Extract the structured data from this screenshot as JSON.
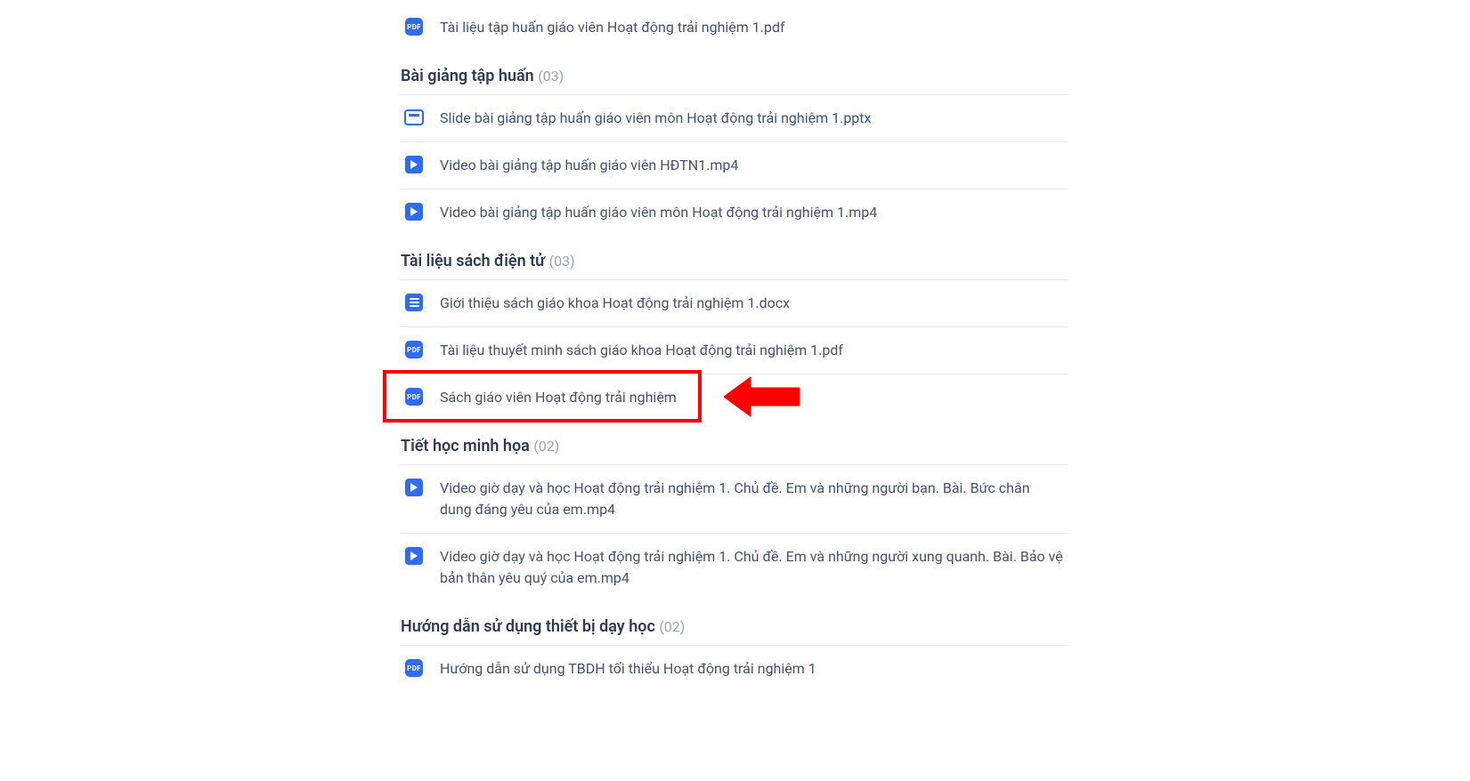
{
  "top_file": {
    "name": "Tài liệu tập huấn giáo viên Hoạt động trải nghiệm 1.pdf",
    "icon": "pdf"
  },
  "sections": [
    {
      "title": "Bài giảng tập huấn",
      "count": "(03)",
      "items": [
        {
          "name": "Slide bài giảng tập huấn giáo viên môn Hoạt động trải nghiệm 1.pptx",
          "icon": "slide"
        },
        {
          "name": "Video bài giảng tập huấn giáo viên HĐTN1.mp4",
          "icon": "video"
        },
        {
          "name": "Video bài giảng tập huấn giáo viên môn Hoạt động trải nghiệm 1.mp4",
          "icon": "video"
        }
      ]
    },
    {
      "title": "Tài liệu sách điện tử",
      "count": "(03)",
      "items": [
        {
          "name": "Giới thiệu sách giáo khoa Hoạt động trải nghiệm 1.docx",
          "icon": "doc"
        },
        {
          "name": "Tài liệu thuyết minh sách giáo khoa Hoạt động trải nghiệm 1.pdf",
          "icon": "pdf"
        },
        {
          "name": "Sách giáo viên Hoạt động trải nghiệm",
          "icon": "pdf",
          "highlighted": true
        }
      ]
    },
    {
      "title": "Tiết học minh họa",
      "count": "(02)",
      "items": [
        {
          "name": "Video giờ dạy và học Hoạt động trải nghiệm 1. Chủ đề. Em và những người bạn. Bài. Bức chân dung đáng yêu của em.mp4",
          "icon": "video"
        },
        {
          "name": "Video giờ dạy và học Hoạt động trải nghiệm 1. Chủ đề. Em và những người xung quanh. Bài. Bảo vệ bản thân yêu quý của em.mp4",
          "icon": "video"
        }
      ]
    },
    {
      "title": "Hướng dẫn sử dụng thiết bị dạy học",
      "count": "(02)",
      "items": [
        {
          "name": "Hướng dẫn sử dụng TBDH tối thiểu Hoạt động trải nghiệm 1",
          "icon": "pdf"
        }
      ]
    }
  ],
  "icon_labels": {
    "pdf": "PDF"
  }
}
